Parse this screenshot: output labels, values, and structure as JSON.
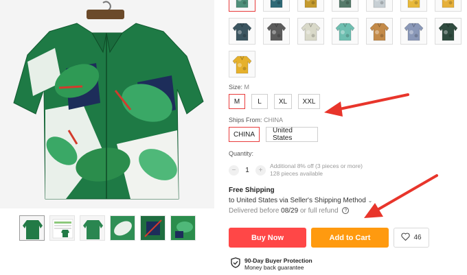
{
  "product": {
    "main_image_alt": "",
    "thumbnail_count": 7,
    "swatch_rows": [
      [
        "#4f8f7a",
        "#2f6a77",
        "#c49a2e",
        "#557a6a",
        "#c7cfd4",
        "#e8b93a",
        "#e6b03a"
      ],
      [
        "#3b5560",
        "#5c5c5c",
        "#d9d9c9",
        "#6fbfb1",
        "#c38a49",
        "#8a98b8",
        "#2f4b3f"
      ],
      [
        "#e6b12c"
      ]
    ]
  },
  "size": {
    "label": "Size:",
    "selected": "M",
    "options": [
      "M",
      "L",
      "XL",
      "XXL"
    ]
  },
  "ships_from": {
    "label": "Ships From:",
    "selected": "CHINA",
    "options": [
      "CHINA",
      "United States"
    ]
  },
  "quantity": {
    "label": "Quantity:",
    "minus": "−",
    "value": "1",
    "plus": "+",
    "discount_note": "Additional 8% off (3 pieces or more)",
    "available": "128 pieces available"
  },
  "shipping": {
    "title": "Free Shipping",
    "line": "to United States via Seller's Shipping Method",
    "chevron": "⌄",
    "delivered_prefix": "Delivered before",
    "delivered_date": "08/29",
    "delivered_suffix": "or full refund",
    "help_glyph": "?"
  },
  "actions": {
    "buy_now": "Buy Now",
    "add_to_cart": "Add to Cart",
    "wishlist_count": "46"
  },
  "protection": {
    "title": "90-Day Buyer Protection",
    "subtitle": "Money back guarantee"
  },
  "colors": {
    "buy": "#ff4747",
    "cart": "#ff9a0f",
    "selected_border": "#e83a3a",
    "annotation": "#e8352b"
  }
}
